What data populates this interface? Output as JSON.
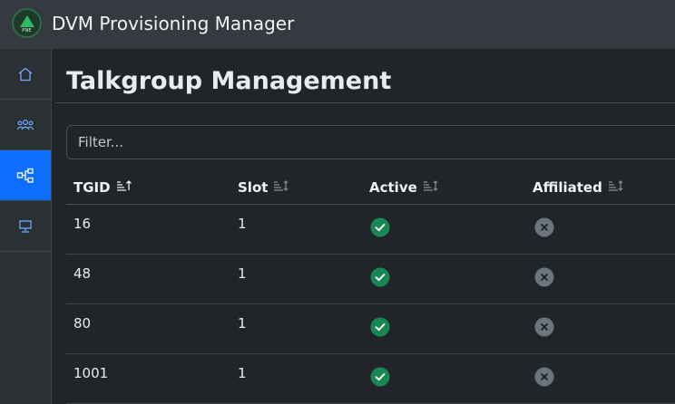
{
  "app": {
    "title": "DVM Provisioning Manager",
    "logo_text": "PNE"
  },
  "sidebar": {
    "items": [
      {
        "icon": "home-icon",
        "active": false
      },
      {
        "icon": "users-icon",
        "active": false
      },
      {
        "icon": "talkgroups-icon",
        "active": true
      },
      {
        "icon": "monitor-icon",
        "active": false
      }
    ]
  },
  "page": {
    "title": "Talkgroup Management"
  },
  "filter": {
    "placeholder": "Filter...",
    "value": ""
  },
  "table": {
    "columns": [
      "TGID",
      "Slot",
      "Active",
      "Affiliated"
    ],
    "rows": [
      {
        "tgid": "16",
        "slot": "1",
        "active": true,
        "affiliated": false
      },
      {
        "tgid": "48",
        "slot": "1",
        "active": true,
        "affiliated": false
      },
      {
        "tgid": "80",
        "slot": "1",
        "active": true,
        "affiliated": false
      },
      {
        "tgid": "1001",
        "slot": "1",
        "active": true,
        "affiliated": false
      }
    ]
  },
  "colors": {
    "accent": "#0d6efd",
    "active_check": "#198754",
    "inactive_x": "#6c757d"
  }
}
